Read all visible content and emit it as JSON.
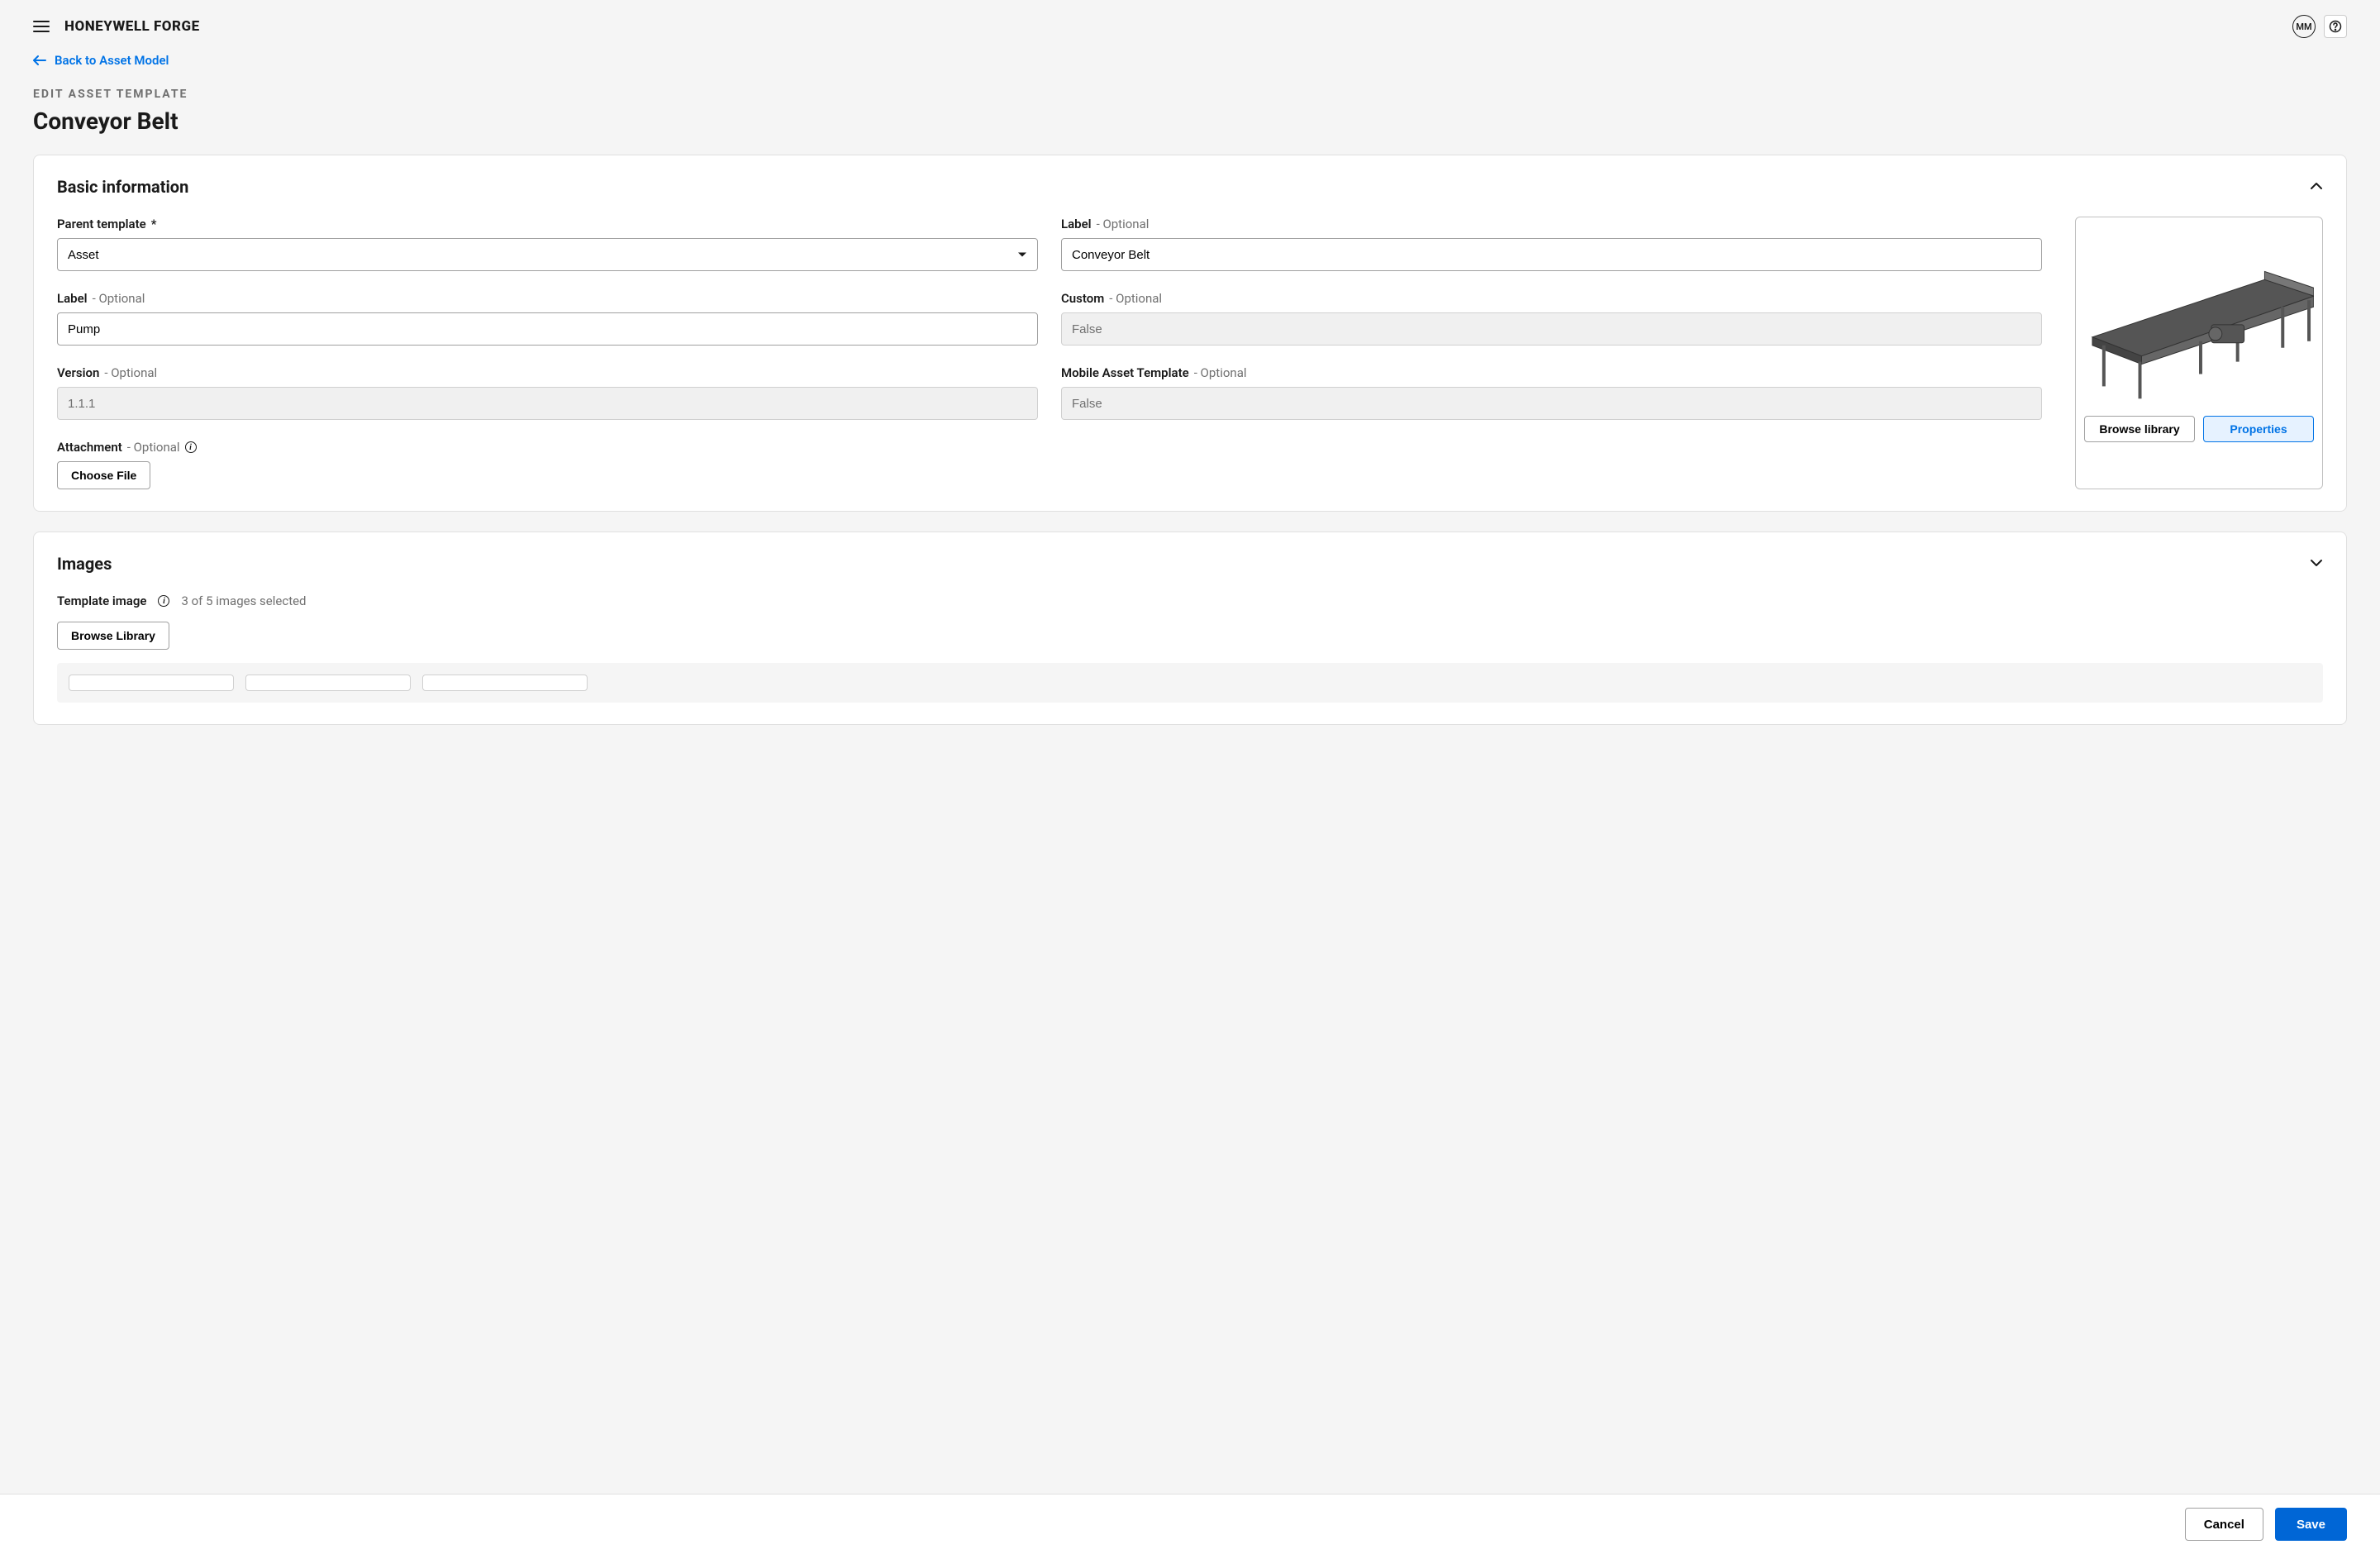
{
  "header": {
    "logo": "HONEYWELL FORGE",
    "avatar_initials": "MM"
  },
  "nav": {
    "back_label": "Back to Asset Model"
  },
  "page": {
    "eyebrow": "EDIT ASSET TEMPLATE",
    "title": "Conveyor Belt"
  },
  "basic_info": {
    "section_title": "Basic information",
    "parent_template": {
      "label": "Parent template",
      "required_marker": "*",
      "value": "Asset"
    },
    "label_top": {
      "label": "Label",
      "suffix": "- Optional",
      "value": "Conveyor Belt"
    },
    "label_bottom": {
      "label": "Label",
      "suffix": "- Optional",
      "value": "Pump"
    },
    "custom": {
      "label": "Custom",
      "suffix": "- Optional",
      "value": "False"
    },
    "version": {
      "label": "Version",
      "suffix": "- Optional",
      "value": "1.1.1"
    },
    "mobile": {
      "label": "Mobile Asset Template",
      "suffix": "- Optional",
      "value": "False"
    },
    "attachment": {
      "label": "Attachment",
      "suffix": "- Optional",
      "button": "Choose File"
    },
    "preview": {
      "browse": "Browse library",
      "properties": "Properties"
    }
  },
  "images": {
    "section_title": "Images",
    "template_label": "Template image",
    "count_text": "3 of 5 images selected",
    "browse": "Browse Library"
  },
  "footer": {
    "cancel": "Cancel",
    "save": "Save"
  }
}
